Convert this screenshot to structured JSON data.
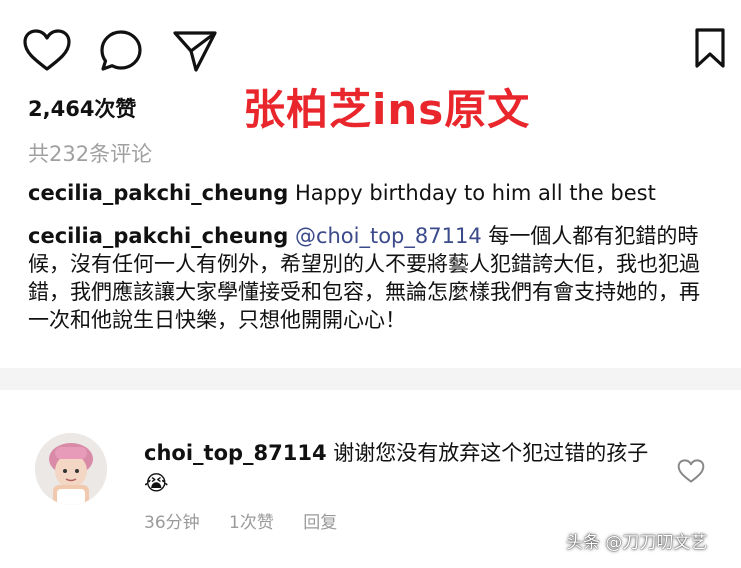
{
  "actions": {
    "like_icon": "heart-outline",
    "comment_icon": "speech-bubble",
    "share_icon": "paper-plane",
    "bookmark_icon": "bookmark-outline"
  },
  "overlay_caption": "张柏芝ins原文",
  "likes": "2,464次赞",
  "comments_count": "共232条评论",
  "caption": {
    "username": "cecilia_pakchi_cheung",
    "text": "Happy birthday to him all the best"
  },
  "comment": {
    "username": "cecilia_pakchi_cheung",
    "mention": "@choi_top_87114",
    "text": "每一個人都有犯錯的時候，沒有任何一人有例外，希望別的人不要將藝人犯錯誇大佢，我也犯過錯，我們應該讓大家學懂接受和包容，無論怎麼樣我們有會支持她的，再一次和他說生日快樂，只想他開開心心！"
  },
  "reply": {
    "username": "choi_top_87114",
    "text": "谢谢您没有放弃这个犯过错的孩子",
    "emoji": "😭",
    "time": "36分钟",
    "likes": "1次赞",
    "reply_label": "回复",
    "heart_icon": "heart-outline"
  },
  "watermark": "头条 @刀刀叨文艺",
  "colors": {
    "overlay_text": "#e8262b",
    "mention": "#3b4a8a",
    "meta_gray": "#9a9a9a"
  }
}
